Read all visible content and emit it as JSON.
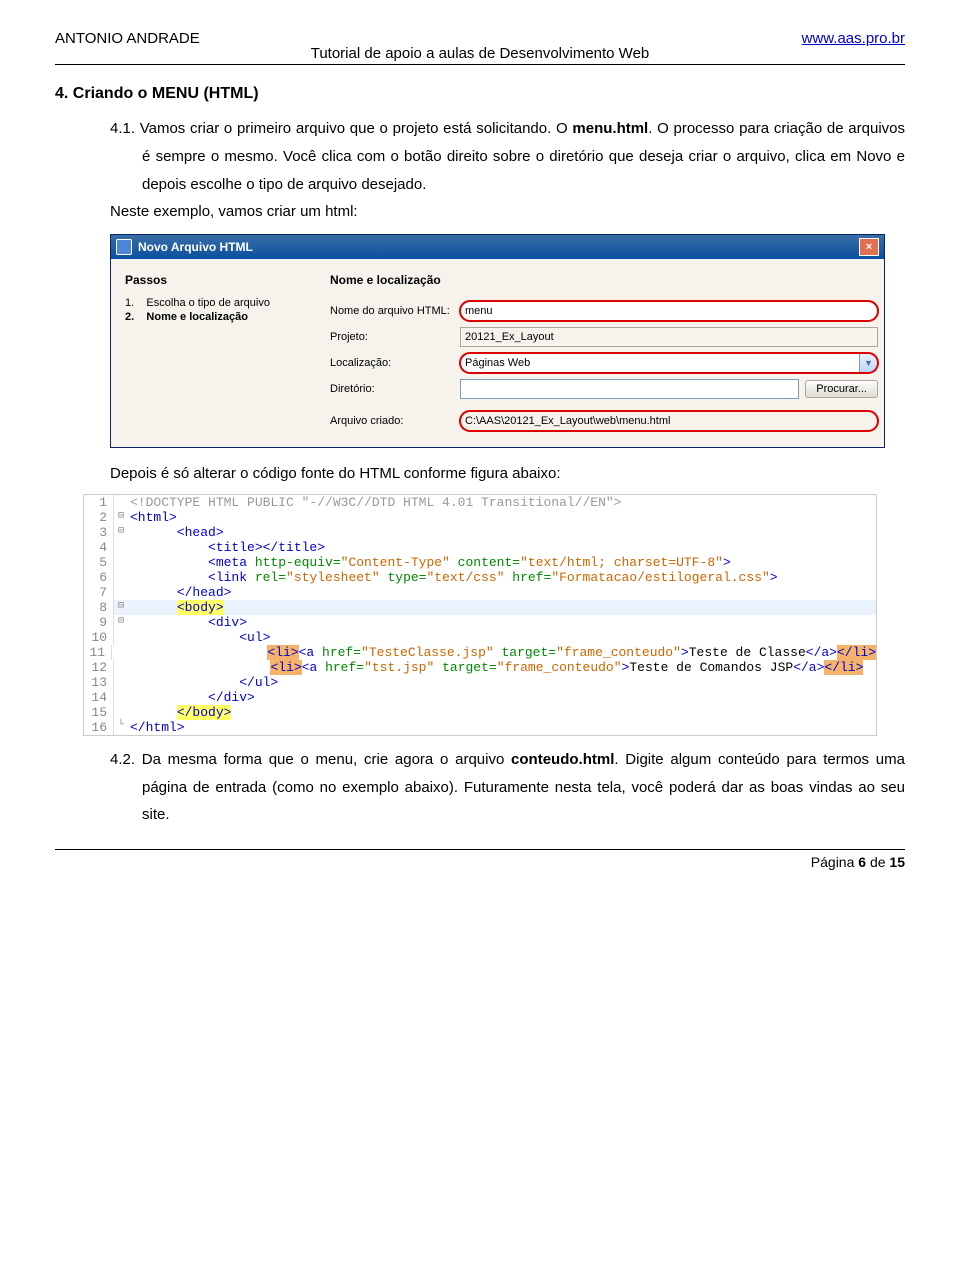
{
  "header": {
    "author": "ANTONIO ANDRADE",
    "url": "www.aas.pro.br",
    "subtitle": "Tutorial de apoio a aulas de Desenvolvimento Web"
  },
  "section": {
    "heading": "4. Criando o MENU (HTML)",
    "p41_prefix": "4.1. Vamos criar o primeiro arquivo que o projeto está solicitando. O ",
    "p41_bold": "menu.html",
    "p41_mid": ". O processo para criação de arquivos é sempre o mesmo. Você clica com o botão direito sobre o diretório que deseja criar o arquivo, clica em Novo e depois escolhe o tipo de arquivo desejado.",
    "p_neste": "Neste exemplo, vamos criar um html:",
    "p_depois": "Depois é só alterar o código fonte do HTML conforme figura abaixo:",
    "p42_prefix": "4.2. Da mesma forma que o menu, crie agora o arquivo ",
    "p42_bold": "conteudo.html",
    "p42_suffix": ".  Digite algum conteúdo para termos uma página de entrada (como no exemplo abaixo). Futuramente nesta tela, você poderá dar as boas vindas ao seu site."
  },
  "dialog": {
    "title": "Novo Arquivo HTML",
    "left_header": "Passos",
    "step1_num": "1.",
    "step1_text": "Escolha o tipo de arquivo",
    "step2_num": "2.",
    "step2_text": "Nome e localização",
    "right_header": "Nome e localização",
    "lbl_nome": "Nome do arquivo HTML:",
    "val_nome": "menu",
    "lbl_projeto": "Projeto:",
    "val_projeto": "20121_Ex_Layout",
    "lbl_localizacao": "Localização:",
    "val_localizacao": "Páginas Web",
    "lbl_diretorio": "Diretório:",
    "val_diretorio": "",
    "btn_procurar": "Procurar...",
    "lbl_criado": "Arquivo criado:",
    "val_criado": "C:\\AAS\\20121_Ex_Layout\\web\\menu.html"
  },
  "code": {
    "l1": "<!DOCTYPE HTML PUBLIC \"-//W3C//DTD HTML 4.01 Transitional//EN\">",
    "l2": "<html>",
    "l3": "<head>",
    "l4": "<title></title>",
    "l5a": "<meta ",
    "l5b": "http-equiv=",
    "l5c": "\"Content-Type\"",
    "l5d": " content=",
    "l5e": "\"text/html; charset=UTF-8\"",
    "l5f": ">",
    "l6a": "<link ",
    "l6b": "rel=",
    "l6c": "\"stylesheet\"",
    "l6d": " type=",
    "l6e": "\"text/css\"",
    "l6f": " href=",
    "l6g": "\"Formatacao/estilogeral.css\"",
    "l6h": ">",
    "l7": "</head>",
    "l8a_pre": "<b",
    "l8a_post": "ody>",
    "l9": "<div>",
    "l10": "<ul>",
    "l11_li": "<li>",
    "l11_a1": "<a ",
    "l11_href": "href=",
    "l11_hrefv": "\"TesteClasse.jsp\"",
    "l11_tgt": " target=",
    "l11_tgtv": "\"frame_conteudo\"",
    "l11_close": ">",
    "l11_txt": "Teste de Classe",
    "l11_ea": "</a>",
    "l11_eli": "</li>",
    "l12_li": "<li>",
    "l12_a1": "<a ",
    "l12_href": "href=",
    "l12_hrefv": "\"tst.jsp\"",
    "l12_tgt": " target=",
    "l12_tgtv": "\"frame_conteudo\"",
    "l12_close": ">",
    "l12_txt": "Teste de Comandos JSP",
    "l12_ea": "</a>",
    "l12_eli": "</li>",
    "l13": "</ul>",
    "l14": "</div>",
    "l15": "</body>",
    "l16": "</html>"
  },
  "footer": {
    "text_prefix": "Página ",
    "page": "6",
    "text_mid": " de ",
    "total": "15"
  }
}
